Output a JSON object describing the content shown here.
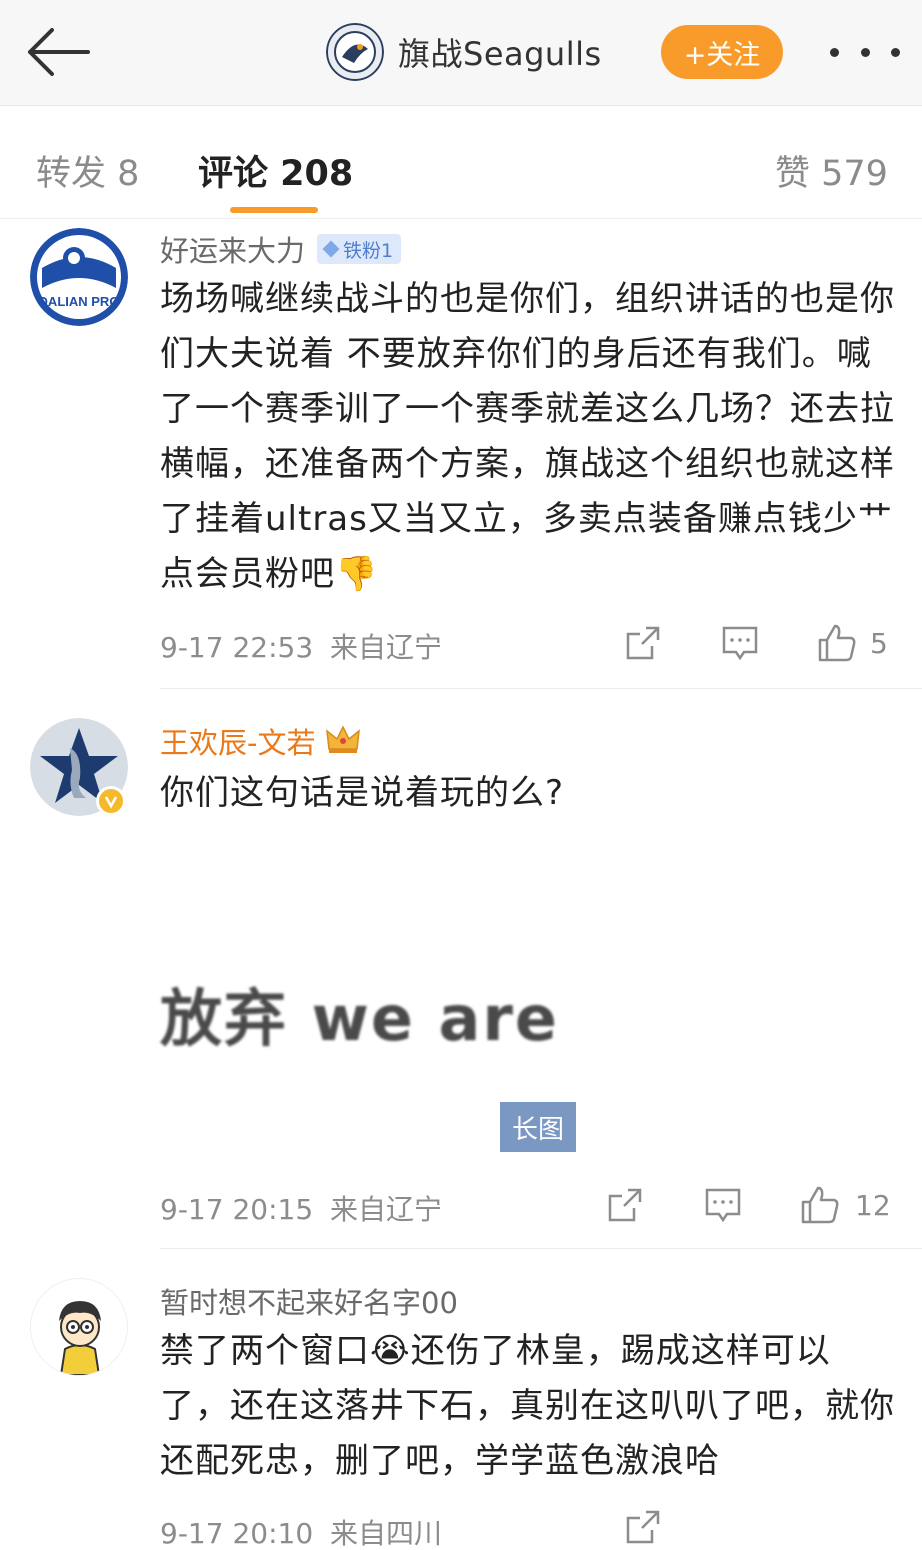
{
  "header": {
    "account_name": "旗战Seagulls",
    "follow_label": "+关注"
  },
  "tabs": {
    "repost": "转发 8",
    "comments": "评论 208",
    "likes": "赞 579"
  },
  "comments": [
    {
      "user": "好运来大力",
      "badge": "铁粉1",
      "avatar_text": "DALIAN PRO",
      "text": "场场喊继续战斗的也是你们，组织讲话的也是你们大夫说着 不要放弃你们的身后还有我们。喊了一个赛季训了一个赛季就差这么几场？还去拉横幅，还准备两个方案，旗战这个组织也就这样了挂着ultras又当又立，多卖点装备赚点钱少艹点会员粉吧👎",
      "time": "9-17 22:53",
      "location": "来自辽宁",
      "likes": "5"
    },
    {
      "user": "王欢辰-文若",
      "text": "你们这句话是说着玩的么?",
      "image_text": "放弃 we are",
      "image_badge": "长图",
      "time": "9-17 20:15",
      "location": "来自辽宁",
      "likes": "12"
    },
    {
      "user": "暂时想不起来好名字00",
      "text": "禁了两个窗口😭还伤了林皇，踢成这样可以了，还在这落井下石，真别在这叭叭了吧，就你还配死忠，删了吧，学学蓝色激浪哈",
      "time": "9-17 20:10",
      "location": "来自四川"
    }
  ],
  "colors": {
    "accent": "#f89b2a",
    "vip_name": "#e9791b",
    "badge_bg": "#dde9fb",
    "long_image_badge": "#7b98c2"
  }
}
